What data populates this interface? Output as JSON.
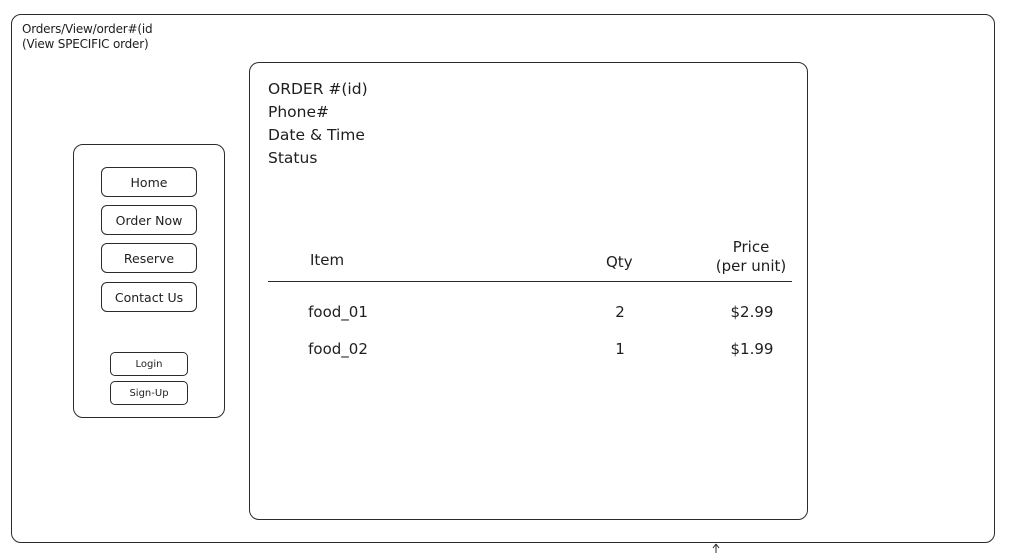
{
  "breadcrumb": {
    "path": "Orders/View/order#(id",
    "subtitle": "(View SPECIFIC order)"
  },
  "sidebar": {
    "nav_items": [
      "Home",
      "Order Now",
      "Reserve",
      "Contact Us"
    ],
    "login_label": "Login",
    "signup_label": "Sign-Up"
  },
  "order": {
    "order_label": "ORDER #(id)",
    "phone_label": "Phone#",
    "datetime_label": "Date & Time",
    "status_label": "Status"
  },
  "table": {
    "headers": {
      "item": "Item",
      "qty": "Qty",
      "price_line1": "Price",
      "price_line2": "(per unit)"
    },
    "rows": [
      {
        "item": "food_01",
        "qty": "2",
        "price": "$2.99"
      },
      {
        "item": "food_02",
        "qty": "1",
        "price": "$1.99"
      }
    ]
  },
  "icons": {
    "cursor": "cursor-icon"
  },
  "colors": {
    "stroke": "#1e1e1e",
    "background": "#ffffff"
  }
}
